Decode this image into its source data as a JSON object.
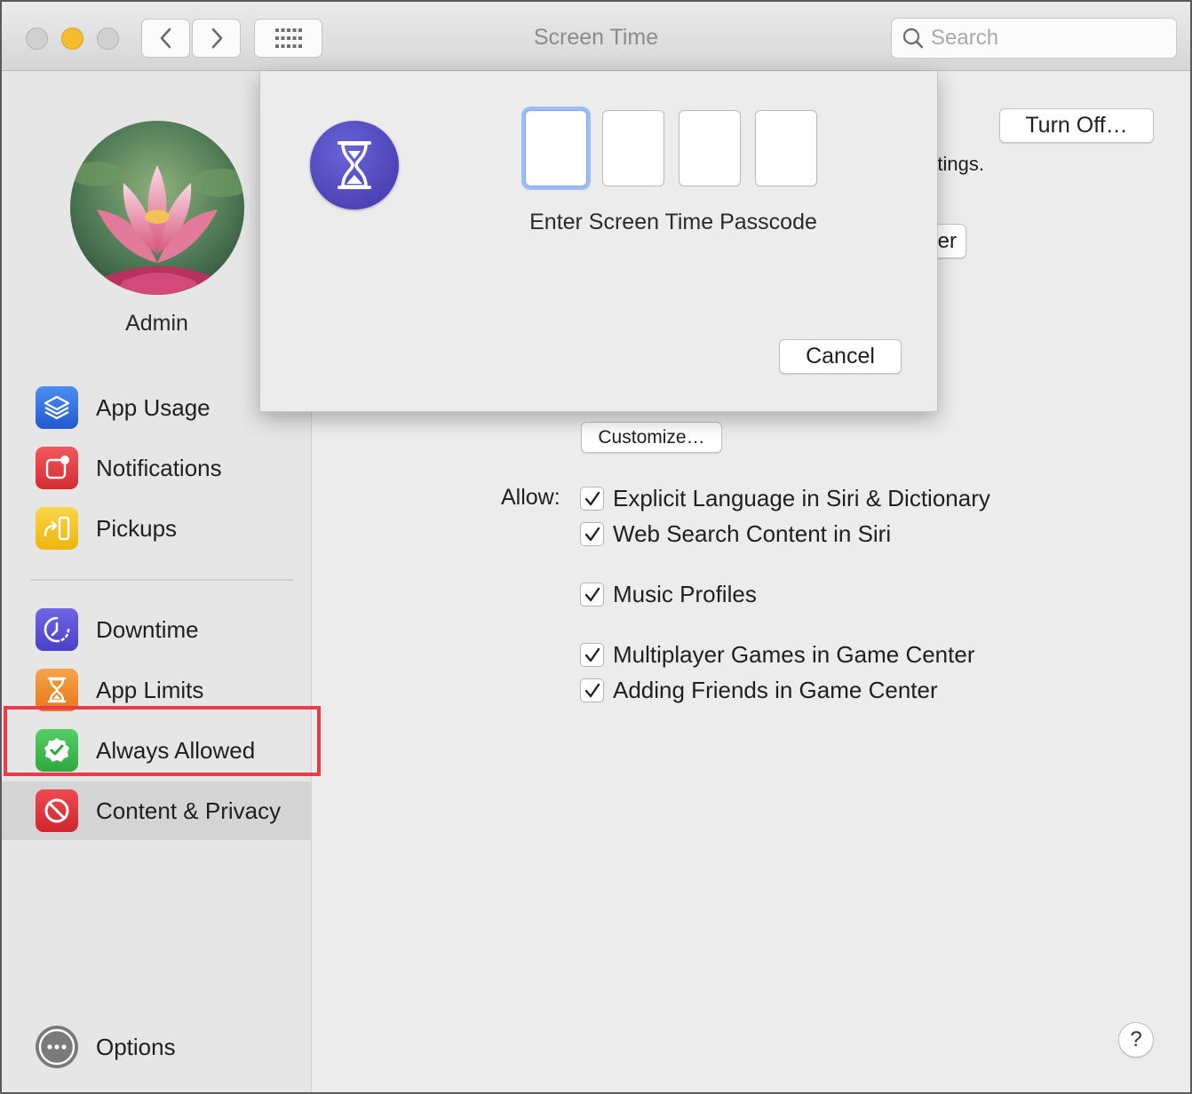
{
  "window": {
    "title": "Screen Time",
    "search_placeholder": "Search"
  },
  "sidebar": {
    "user_name": "Admin",
    "items": [
      {
        "label": "App Usage",
        "icon": "app-usage-icon",
        "color": "#2f6fe0"
      },
      {
        "label": "Notifications",
        "icon": "notifications-icon",
        "color": "#e5383b"
      },
      {
        "label": "Pickups",
        "icon": "pickups-icon",
        "color": "#f4c20d"
      },
      {
        "label": "Downtime",
        "icon": "downtime-icon",
        "color": "#5a4fd0"
      },
      {
        "label": "App Limits",
        "icon": "app-limits-icon",
        "color": "#f08a24"
      },
      {
        "label": "Always Allowed",
        "icon": "always-allowed-icon",
        "color": "#3dbb4f"
      },
      {
        "label": "Content & Privacy",
        "icon": "content-privacy-icon",
        "color": "#e2343a",
        "selected": true
      }
    ],
    "options_label": "Options"
  },
  "main": {
    "turn_off_label": "Turn Off…",
    "partial_settings_text": "ettings.",
    "partial_button_text": "er",
    "customize_label": "Customize…",
    "allow_label": "Allow:",
    "checkboxes": [
      {
        "label": "Explicit Language in Siri & Dictionary",
        "checked": true
      },
      {
        "label": "Web Search Content in Siri",
        "checked": true
      },
      {
        "label": "Music Profiles",
        "checked": true
      },
      {
        "label": "Multiplayer Games in Game Center",
        "checked": true
      },
      {
        "label": "Adding Friends in Game Center",
        "checked": true
      }
    ],
    "help_label": "?"
  },
  "sheet": {
    "prompt": "Enter Screen Time Passcode",
    "cancel_label": "Cancel",
    "pin_digits": [
      "",
      "",
      "",
      ""
    ]
  },
  "colors": {
    "highlight": "#ec3b48",
    "focus_ring": "#9dbdf6",
    "screen_time_icon": "#4a42b8"
  }
}
